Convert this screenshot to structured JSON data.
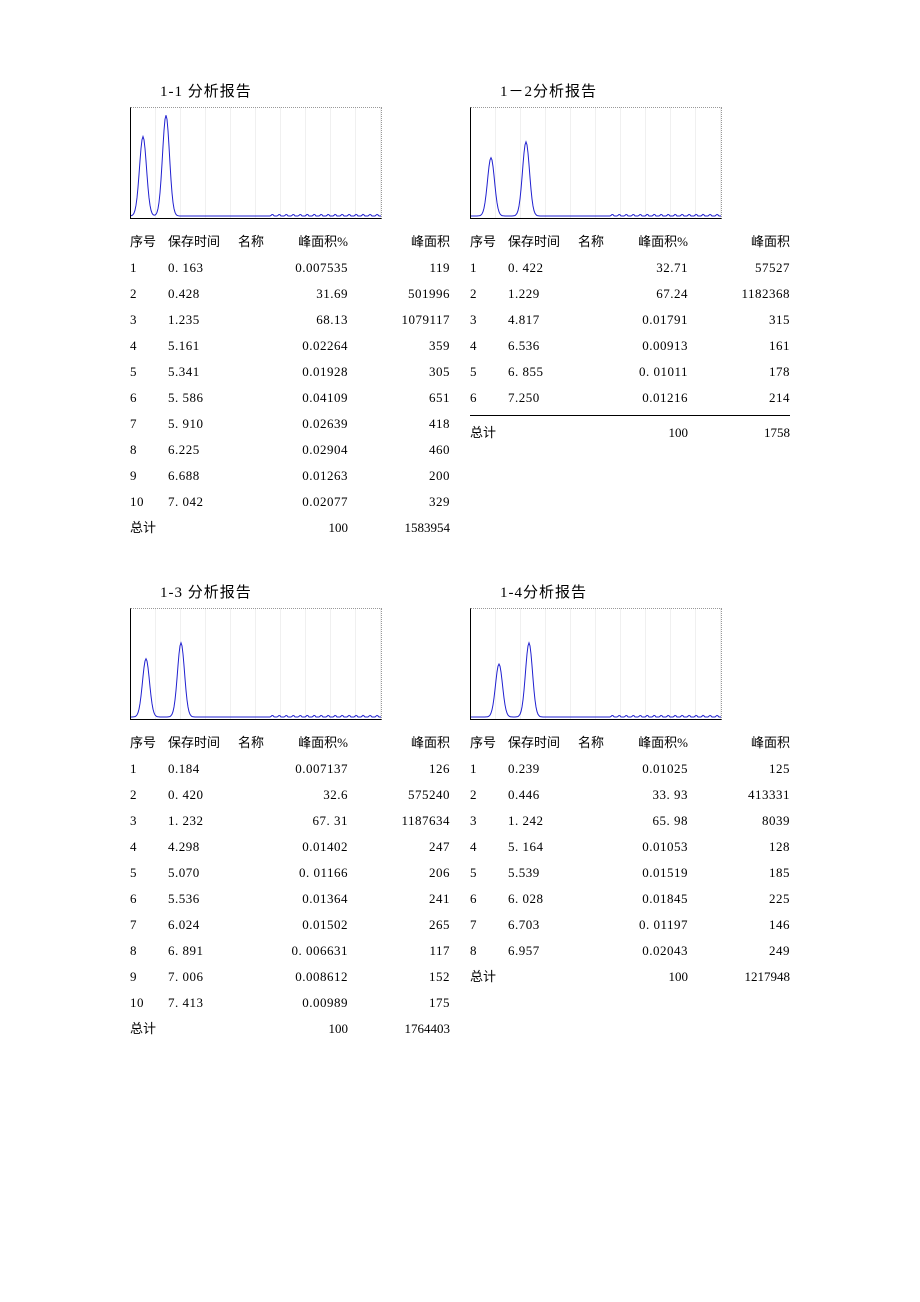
{
  "cols": {
    "idx": "序号",
    "rt": "保存时间",
    "name": "名称",
    "pct": "峰面积%",
    "area": "峰面积"
  },
  "total_label": "总计",
  "reports": [
    {
      "title": "1-1 分析报告",
      "peaks_x": [
        12,
        35
      ],
      "peaks_h": [
        0.75,
        0.95
      ],
      "rows": [
        {
          "idx": "1",
          "rt": "0. 163",
          "pct": "0.007535",
          "area": "119"
        },
        {
          "idx": "2",
          "rt": "0.428",
          "pct": "31.69",
          "area": "501996"
        },
        {
          "idx": "3",
          "rt": "1.235",
          "pct": "68.13",
          "area": "1079117"
        },
        {
          "idx": "4",
          "rt": "5.161",
          "pct": "0.02264",
          "area": "359"
        },
        {
          "idx": "5",
          "rt": "5.341",
          "pct": "0.01928",
          "area": "305"
        },
        {
          "idx": "6",
          "rt": "5. 586",
          "pct": "0.04109",
          "area": "651"
        },
        {
          "idx": "7",
          "rt": "5. 910",
          "pct": "0.02639",
          "area": "418"
        },
        {
          "idx": "8",
          "rt": "6.225",
          "pct": "0.02904",
          "area": "460"
        },
        {
          "idx": "9",
          "rt": "6.688",
          "pct": "0.01263",
          "area": "200"
        },
        {
          "idx": "10",
          "rt": "7. 042",
          "pct": "0.02077",
          "area": "329"
        }
      ],
      "total_pct": "100",
      "total_area": "1583954"
    },
    {
      "title": "1－2分析报告",
      "peaks_x": [
        20,
        55
      ],
      "peaks_h": [
        0.55,
        0.7
      ],
      "rows": [
        {
          "idx": "1",
          "rt": "0. 422",
          "pct": "32.71",
          "area": "57527"
        },
        {
          "idx": "2",
          "rt": "1.229",
          "pct": "67.24",
          "area": "1182368"
        },
        {
          "idx": "3",
          "rt": "4.817",
          "pct": "0.01791",
          "area": "315"
        },
        {
          "idx": "4",
          "rt": "6.536",
          "pct": "0.00913",
          "area": "161"
        },
        {
          "idx": "5",
          "rt": "6. 855",
          "pct": "0. 01011",
          "area": "178"
        },
        {
          "idx": "6",
          "rt": "7.250",
          "pct": "0.01216",
          "area": "214"
        }
      ],
      "total_pct": "100",
      "total_area": "1758",
      "divider_before_total": true
    },
    {
      "title": "1-3 分析报告",
      "peaks_x": [
        15,
        50
      ],
      "peaks_h": [
        0.55,
        0.7
      ],
      "rows": [
        {
          "idx": "1",
          "rt": "0.184",
          "pct": "0.007137",
          "area": "126"
        },
        {
          "idx": "2",
          "rt": "0. 420",
          "pct": "32.6",
          "area": "575240"
        },
        {
          "idx": "3",
          "rt": "1. 232",
          "pct": "67. 31",
          "area": "1187634"
        },
        {
          "idx": "4",
          "rt": "4.298",
          "pct": "0.01402",
          "area": "247"
        },
        {
          "idx": "5",
          "rt": "5.070",
          "pct": "0. 01166",
          "area": "206"
        },
        {
          "idx": "6",
          "rt": "5.536",
          "pct": "0.01364",
          "area": "241"
        },
        {
          "idx": "7",
          "rt": "6.024",
          "pct": "0.01502",
          "area": "265"
        },
        {
          "idx": "8",
          "rt": "6. 891",
          "pct": "0. 006631",
          "area": "117"
        },
        {
          "idx": "9",
          "rt": "7. 006",
          "pct": "0.008612",
          "area": "152"
        },
        {
          "idx": "10",
          "rt": "7. 413",
          "pct": "0.00989",
          "area": "175"
        }
      ],
      "total_pct": "100",
      "total_area": "1764403"
    },
    {
      "title": "1-4分析报告",
      "peaks_x": [
        28,
        58
      ],
      "peaks_h": [
        0.5,
        0.7
      ],
      "rows": [
        {
          "idx": "1",
          "rt": "0.239",
          "pct": "0.01025",
          "area": "125"
        },
        {
          "idx": "2",
          "rt": "0.446",
          "pct": "33. 93",
          "area": "413331"
        },
        {
          "idx": "3",
          "rt": "1. 242",
          "pct": "65. 98",
          "area": "8039"
        },
        {
          "idx": "4",
          "rt": "5. 164",
          "pct": "0.01053",
          "area": "128"
        },
        {
          "idx": "5",
          "rt": "5.539",
          "pct": "0.01519",
          "area": "185"
        },
        {
          "idx": "6",
          "rt": "6. 028",
          "pct": "0.01845",
          "area": "225"
        },
        {
          "idx": "7",
          "rt": "6.703",
          "pct": "0. 01197",
          "area": "146"
        },
        {
          "idx": "8",
          "rt": "6.957",
          "pct": "0.02043",
          "area": "249"
        }
      ],
      "total_pct": "100",
      "total_area": "1217948"
    }
  ]
}
